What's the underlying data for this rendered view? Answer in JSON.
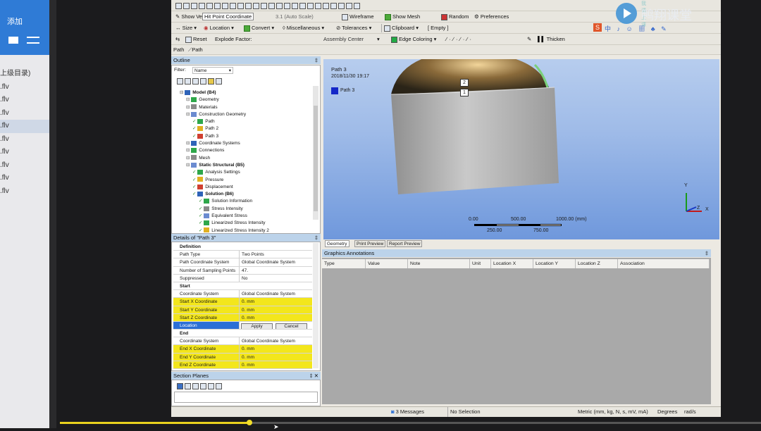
{
  "player": {
    "add_label": "添加",
    "playlist": [
      "上级目录)",
      ".flv",
      ".flv",
      ".flv",
      ".flv",
      ".flv",
      ".flv",
      ".flv",
      ".flv",
      ".flv",
      "0.flv"
    ],
    "selected_index": 4,
    "progress": 0.27
  },
  "toolbar": {
    "show_vertices": "Show Ve",
    "hit_point": "Hit Point Coordinate",
    "auto_scale": "3.1 (Auto Scale)",
    "wireframe": "Wireframe",
    "show_mesh": "Show Mesh",
    "random": "Random",
    "preferences": "Preferences",
    "size": "Size",
    "location": "Location",
    "convert": "Convert",
    "miscellaneous": "Miscellaneous",
    "tolerances": "Tolerances",
    "clipboard": "Clipboard",
    "empty": "[ Empty ]",
    "reset": "Reset",
    "explode_factor": "Explode Factor:",
    "assembly_center": "Assembly Center",
    "edge_coloring": "Edge Coloring",
    "thicken": "Thicken",
    "path_label": "Path",
    "path_button": "Path"
  },
  "outline": {
    "title": "Outline",
    "filter_label": "Filter:",
    "filter_value": "Name",
    "tree": [
      {
        "label": "Model (B4)",
        "indent": 0,
        "bold": true
      },
      {
        "label": "Geometry",
        "indent": 1
      },
      {
        "label": "Materials",
        "indent": 1
      },
      {
        "label": "Construction Geometry",
        "indent": 1
      },
      {
        "label": "Path",
        "indent": 2
      },
      {
        "label": "Path 2",
        "indent": 2
      },
      {
        "label": "Path 3",
        "indent": 2
      },
      {
        "label": "Coordinate Systems",
        "indent": 1
      },
      {
        "label": "Connections",
        "indent": 1
      },
      {
        "label": "Mesh",
        "indent": 1
      },
      {
        "label": "Static Structural (B5)",
        "indent": 1,
        "bold": true
      },
      {
        "label": "Analysis Settings",
        "indent": 2
      },
      {
        "label": "Pressure",
        "indent": 2
      },
      {
        "label": "Displacement",
        "indent": 2
      },
      {
        "label": "Solution (B6)",
        "indent": 2,
        "bold": true
      },
      {
        "label": "Solution Information",
        "indent": 3
      },
      {
        "label": "Stress Intensity",
        "indent": 3
      },
      {
        "label": "Equivalent Stress",
        "indent": 3
      },
      {
        "label": "Linearized Stress Intensity",
        "indent": 3
      },
      {
        "label": "Linearized Stress Intensity 2",
        "indent": 3
      }
    ]
  },
  "details": {
    "title": "Details of \"Path 3\"",
    "rows": [
      {
        "k": "Definition",
        "v": "",
        "type": "sec"
      },
      {
        "k": "Path Type",
        "v": "Two Points"
      },
      {
        "k": "Path Coordinate System",
        "v": "Global Coordinate System"
      },
      {
        "k": "Number of Sampling Points",
        "v": "47."
      },
      {
        "k": "Suppressed",
        "v": "No"
      },
      {
        "k": "Start",
        "v": "",
        "type": "sec"
      },
      {
        "k": "Coordinate System",
        "v": "Global Coordinate System"
      },
      {
        "k": "Start X Coordinate",
        "v": "0. mm",
        "type": "yel"
      },
      {
        "k": "Start Y Coordinate",
        "v": "0. mm",
        "type": "yel"
      },
      {
        "k": "Start Z Coordinate",
        "v": "0. mm",
        "type": "yel"
      },
      {
        "k": "Location",
        "v": "",
        "type": "loc"
      },
      {
        "k": "End",
        "v": "",
        "type": "sec"
      },
      {
        "k": "Coordinate System",
        "v": "Global Coordinate System"
      },
      {
        "k": "End X Coordinate",
        "v": "0. mm",
        "type": "yel"
      },
      {
        "k": "End Y Coordinate",
        "v": "0. mm",
        "type": "yel"
      },
      {
        "k": "End Z Coordinate",
        "v": "0. mm",
        "type": "yel"
      }
    ],
    "apply": "Apply",
    "cancel": "Cancel"
  },
  "section_planes": {
    "title": "Section Planes"
  },
  "viewport": {
    "title": "Path 3",
    "date": "2018/11/30 19:17",
    "legend": "Path 3",
    "marker1": "2",
    "marker2": "1",
    "scale_labels": [
      "0.00",
      "500.00",
      "1000.00 (mm)"
    ],
    "scale_labels_lower": [
      "250.00",
      "750.00"
    ],
    "axis_y": "Y",
    "axis_z": "Z",
    "axis_x": "X"
  },
  "view_tabs": [
    "Geometry",
    "Print Preview",
    "Report Preview"
  ],
  "graphics_annotations": {
    "title": "Graphics Annotations",
    "columns": [
      "Type",
      "Value",
      "Note",
      "Unit",
      "Location X",
      "Location Y",
      "Location Z",
      "Association"
    ]
  },
  "status": {
    "messages": "3 Messages",
    "selection": "No Selection",
    "units": "Metric (mm, kg, N, s, mV, mA)",
    "degrees": "Degrees",
    "rads": "rad/s"
  },
  "watermark": {
    "text": "鸭翔课堂",
    "small": "我课上课"
  },
  "colors": {
    "accent": "#2b6fd6",
    "highlight": "#f3e61c",
    "player_blue": "#2f7bd6"
  }
}
